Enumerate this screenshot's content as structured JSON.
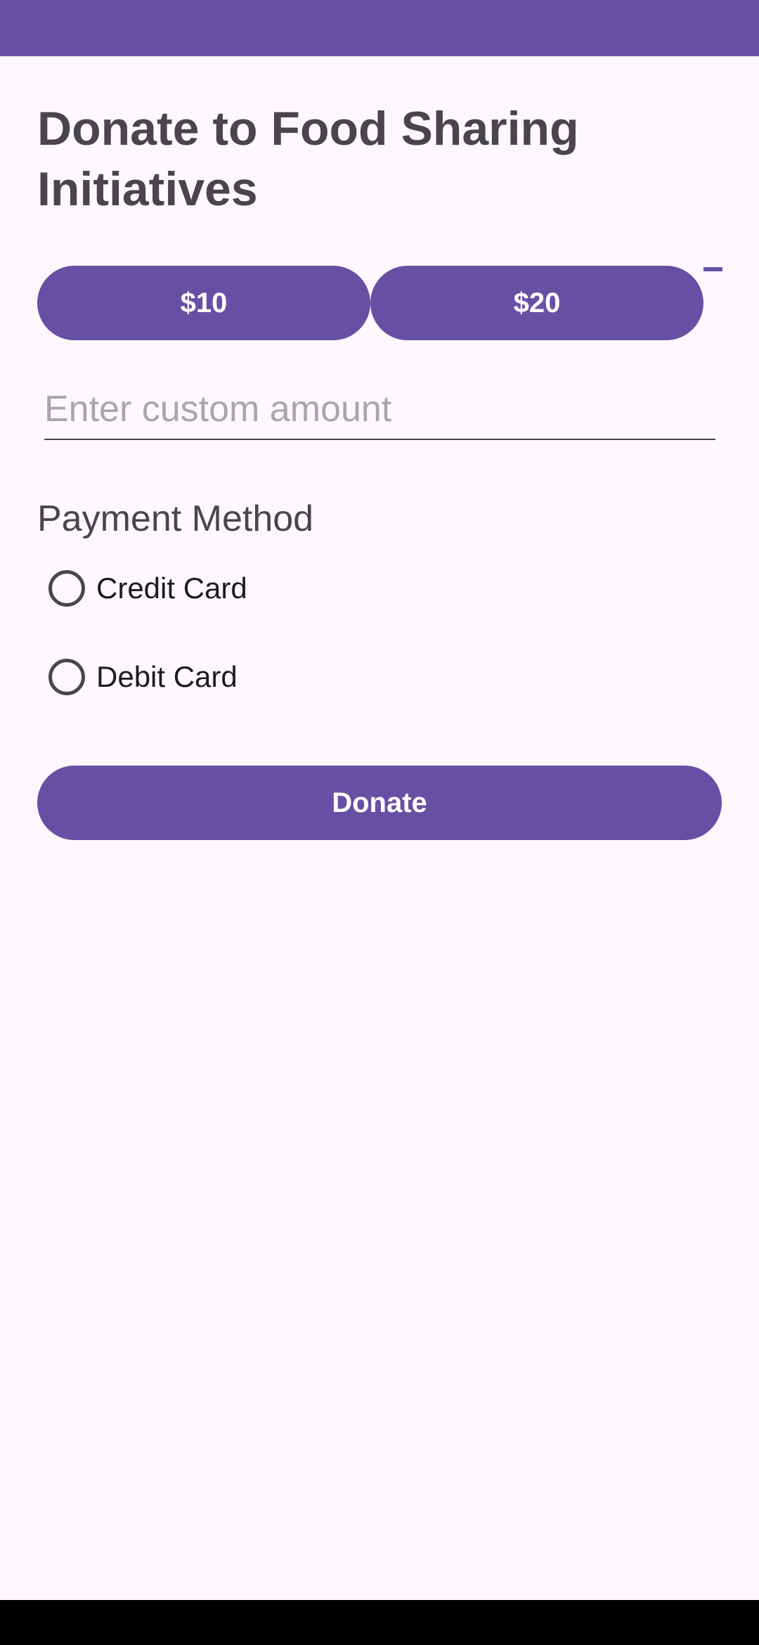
{
  "colors": {
    "primary": "#6750A4",
    "background": "#FFF7FE",
    "on_surface_variant": "#49454F",
    "on_surface": "#1D1B20",
    "nav_bar": "#000000"
  },
  "page": {
    "title": "Donate to Food Sharing Initiatives"
  },
  "amounts": {
    "option_1": "$10",
    "option_2": "$20"
  },
  "custom_amount": {
    "placeholder": "Enter custom amount",
    "value": ""
  },
  "payment": {
    "section_title": "Payment Method",
    "options": [
      {
        "label": "Credit Card",
        "selected": false
      },
      {
        "label": "Debit Card",
        "selected": false
      }
    ]
  },
  "actions": {
    "donate_label": "Donate"
  }
}
